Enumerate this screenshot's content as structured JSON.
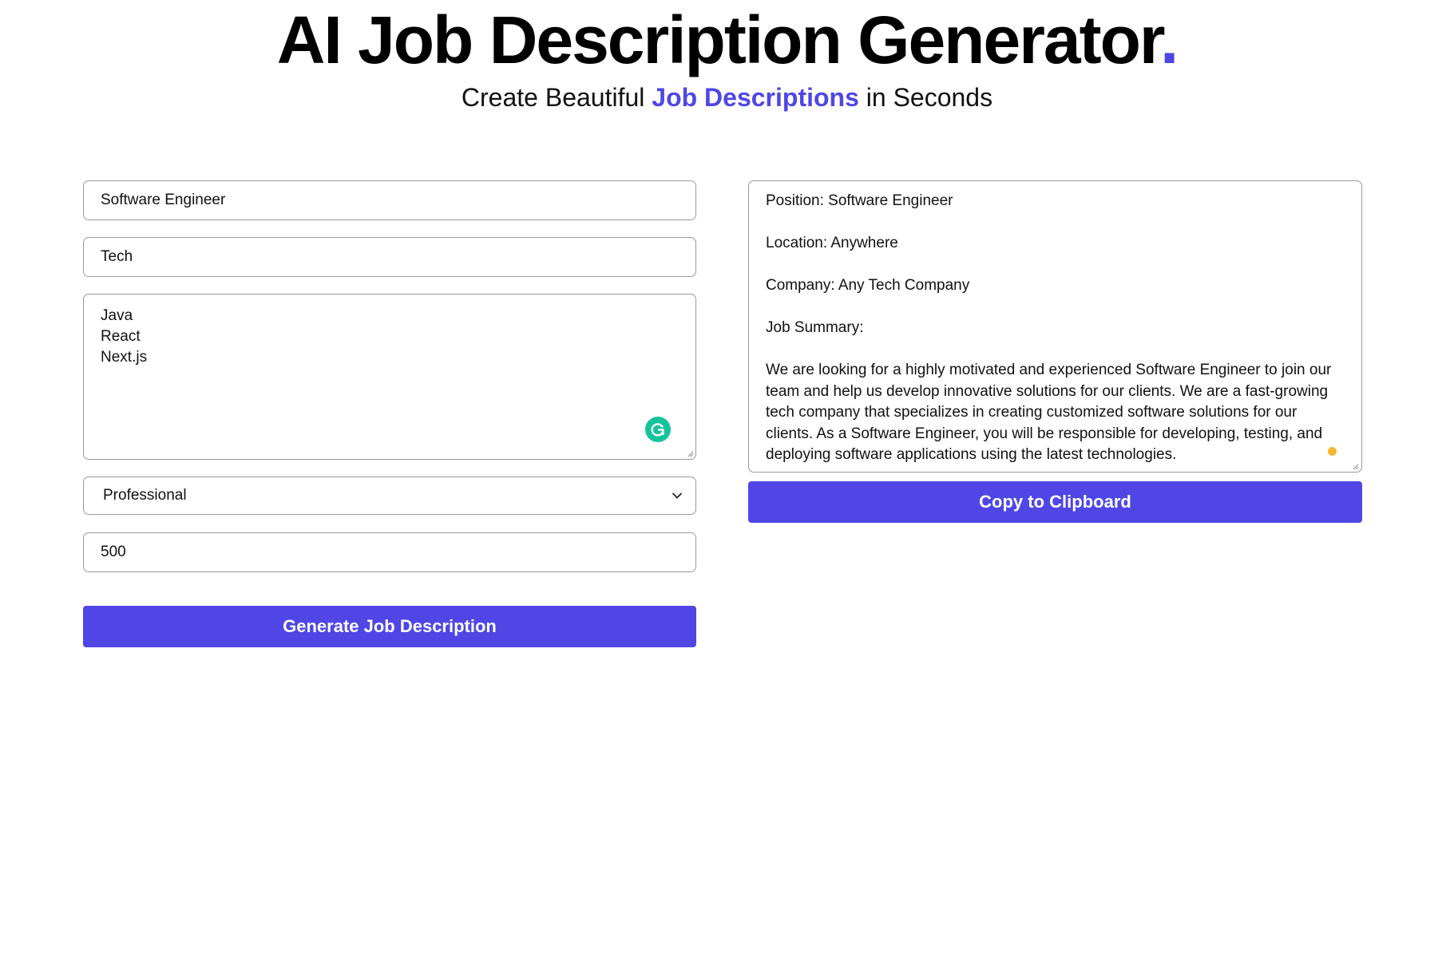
{
  "header": {
    "title": "AI Job Description Generator",
    "title_dot": ".",
    "subtitle_before": "Create Beautiful ",
    "subtitle_highlight": "Job Descriptions",
    "subtitle_after": " in Seconds"
  },
  "form": {
    "job_title_value": "Software Engineer",
    "industry_value": "Tech",
    "keywords_value": "Java\nReact\nNext.js",
    "tone_selected": "Professional",
    "word_limit_value": "500",
    "generate_label": "Generate Job Description"
  },
  "output": {
    "paragraphs": [
      "Position: Software Engineer",
      "Location: Anywhere",
      "Company: Any Tech Company",
      "Job Summary:",
      "We are looking for a highly motivated and experienced Software Engineer to join our team and help us develop innovative solutions for our clients. We are a fast-growing tech company that specializes in creating customized software solutions for our clients. As a Software Engineer, you will be responsible for developing, testing, and deploying software applications using the latest technologies."
    ],
    "copy_label": "Copy to Clipboard"
  },
  "colors": {
    "accent": "#4f46e5",
    "grammarly": "#15c39a",
    "status_dot": "#f7b733"
  },
  "icons": {
    "grammarly": "grammarly-icon",
    "select_chevron": "chevron-down-icon",
    "status": "status-dot-icon"
  }
}
